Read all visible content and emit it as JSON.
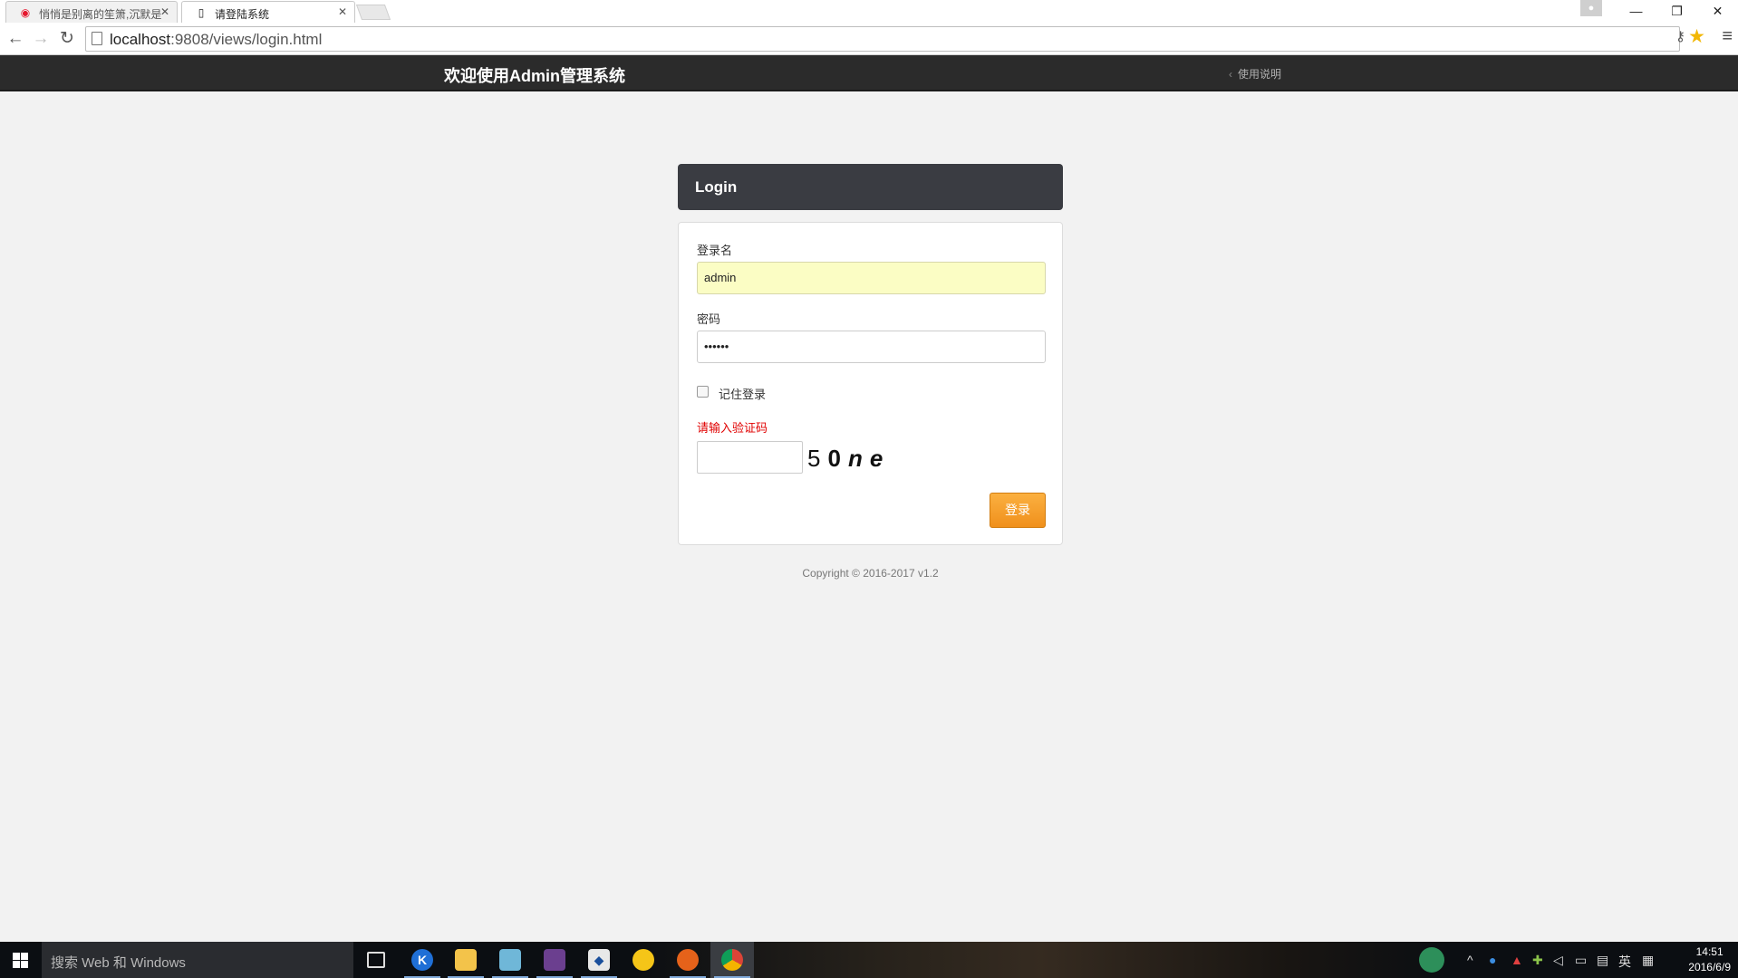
{
  "browser": {
    "tabs": [
      {
        "title": "悄悄是别离的笙箫,沉默是"
      },
      {
        "title": "请登陆系统"
      }
    ],
    "url_host": "localhost",
    "url_rest": ":9808/views/login.html"
  },
  "header": {
    "brand": "欢迎使用Admin管理系统",
    "help_link": "使用说明"
  },
  "login": {
    "title": "Login",
    "username_label": "登录名",
    "username_value": "admin",
    "password_label": "密码",
    "password_masked": "••••••",
    "remember_label": "记住登录",
    "captcha_hint": "请输入验证码",
    "captcha_chars": [
      "5",
      "0",
      "n",
      "e"
    ],
    "submit_label": "登录",
    "copyright": "Copyright © 2016-2017 v1.2"
  },
  "taskbar": {
    "search_placeholder": "搜索 Web 和 Windows",
    "ime_label": "英",
    "time": "14:51",
    "date": "2016/6/9"
  },
  "colors": {
    "navbar": "#2b2b2b",
    "login_header": "#3a3c42",
    "submit_button": "#f5a02a",
    "captcha_hint": "#e00000",
    "autofill": "#fbfdc4"
  }
}
